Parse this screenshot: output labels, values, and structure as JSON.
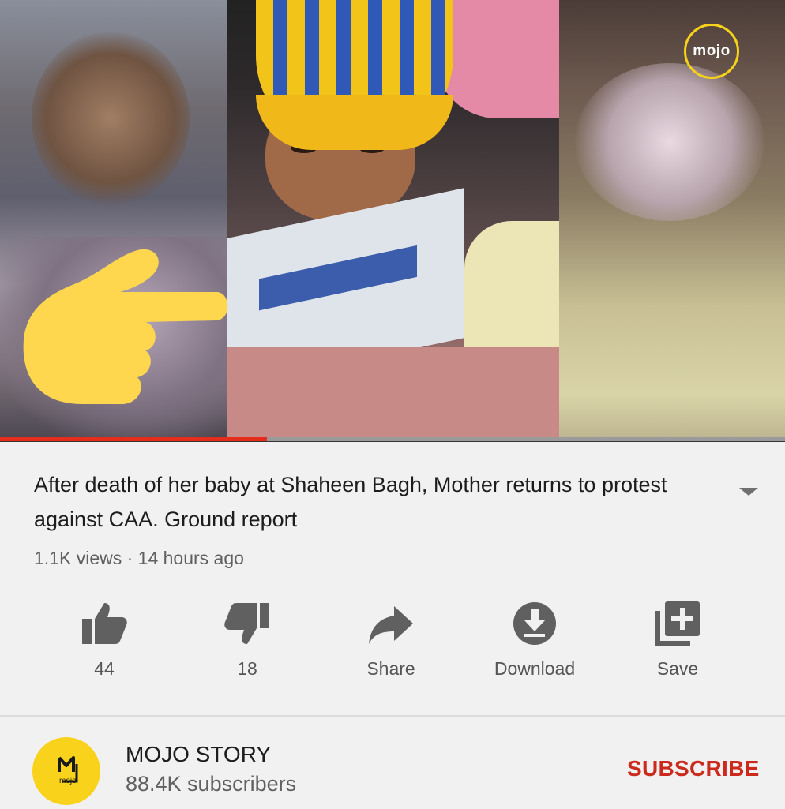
{
  "player": {
    "brand_logo": "mojo",
    "progress_fraction": 0.34,
    "accent": "#e52d1c"
  },
  "video": {
    "title": "After death of her baby at Shaheen Bagh, Mother returns to protest against CAA. Ground report",
    "meta": "1.1K views · 14 hours ago"
  },
  "actions": [
    {
      "icon": "thumbs-up-icon",
      "label": "44"
    },
    {
      "icon": "thumbs-down-icon",
      "label": "18"
    },
    {
      "icon": "share-icon",
      "label": "Share"
    },
    {
      "icon": "download-icon",
      "label": "Download"
    },
    {
      "icon": "save-playlist-icon",
      "label": "Save"
    }
  ],
  "channel": {
    "name": "MOJO STORY",
    "subscribers": "88.4K subscribers",
    "avatar_mark": "mojo",
    "subscribe_label": "SUBSCRIBE",
    "subscribe_color": "#cc2a1c"
  }
}
